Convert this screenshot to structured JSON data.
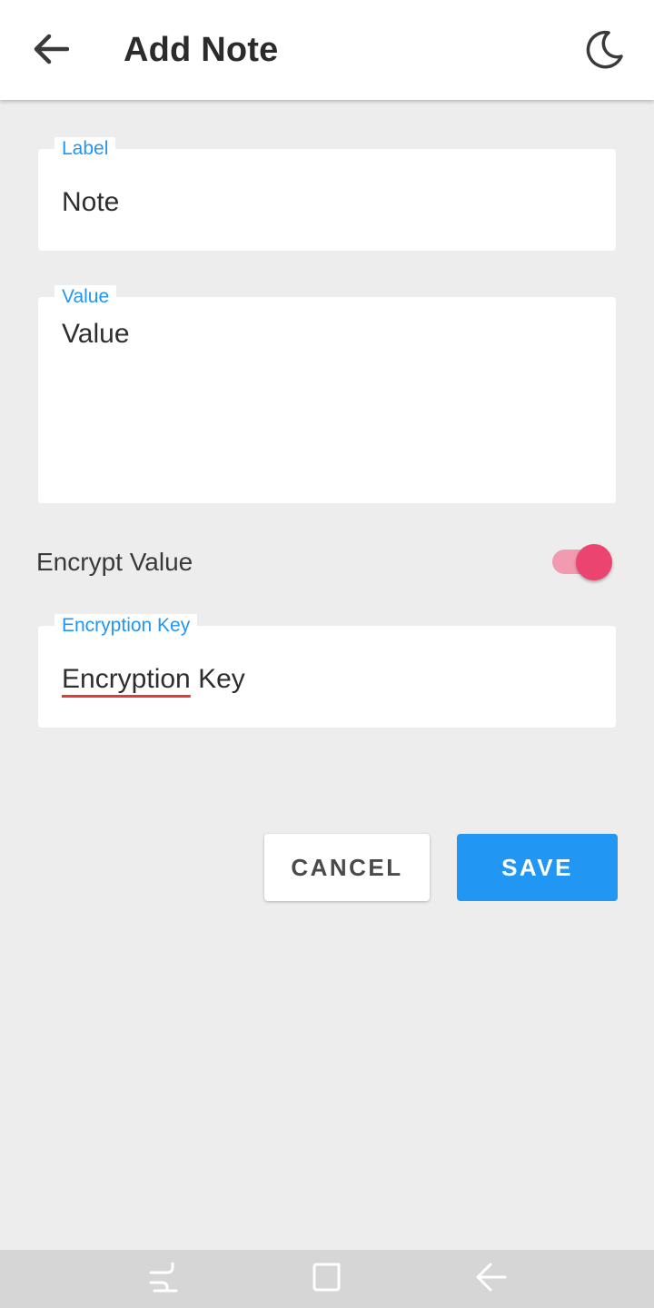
{
  "appbar": {
    "title": "Add Note",
    "back_icon": "arrow-left-icon",
    "theme_icon": "moon-icon"
  },
  "form": {
    "label_field": {
      "label": "Label",
      "value": "Note"
    },
    "value_field": {
      "label": "Value",
      "value": "Value"
    },
    "encrypt": {
      "label": "Encrypt Value",
      "enabled": true
    },
    "key_field": {
      "label": "Encryption Key",
      "value_part1": "Encryption",
      "value_part2": " Key"
    }
  },
  "actions": {
    "cancel_label": "CANCEL",
    "save_label": "SAVE"
  },
  "system_nav": {
    "recents_icon": "recents-icon",
    "home_icon": "home-icon",
    "back_icon": "nav-back-icon"
  },
  "colors": {
    "accent": "#2196f3",
    "switch_thumb": "#ec4470",
    "switch_track": "#f29bb0",
    "background": "#ededed"
  }
}
